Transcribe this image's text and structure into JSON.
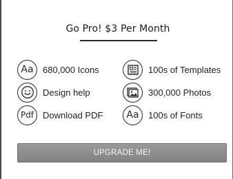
{
  "promo": {
    "title": "Go Pro! $3 Per Month"
  },
  "features": [
    {
      "icon": "font-aa-icon",
      "icon_text": "Aa",
      "label": "680,000 Icons"
    },
    {
      "icon": "template-icon",
      "icon_text": "",
      "label": "100s of Templates"
    },
    {
      "icon": "smiley-icon",
      "icon_text": "",
      "label": "Design help"
    },
    {
      "icon": "photo-icon",
      "icon_text": "",
      "label": "300,000 Photos"
    },
    {
      "icon": "pdf-icon",
      "icon_text": "Pdf",
      "label": "Download PDF"
    },
    {
      "icon": "font-aa-icon",
      "icon_text": "Aa",
      "label": "100s of Fonts"
    }
  ],
  "upgrade_button": {
    "label": "UPGRADE ME!"
  },
  "colors": {
    "button_bg": "#8c8c8c",
    "button_text": "#f4f4f4",
    "text": "#1e1e1e"
  }
}
